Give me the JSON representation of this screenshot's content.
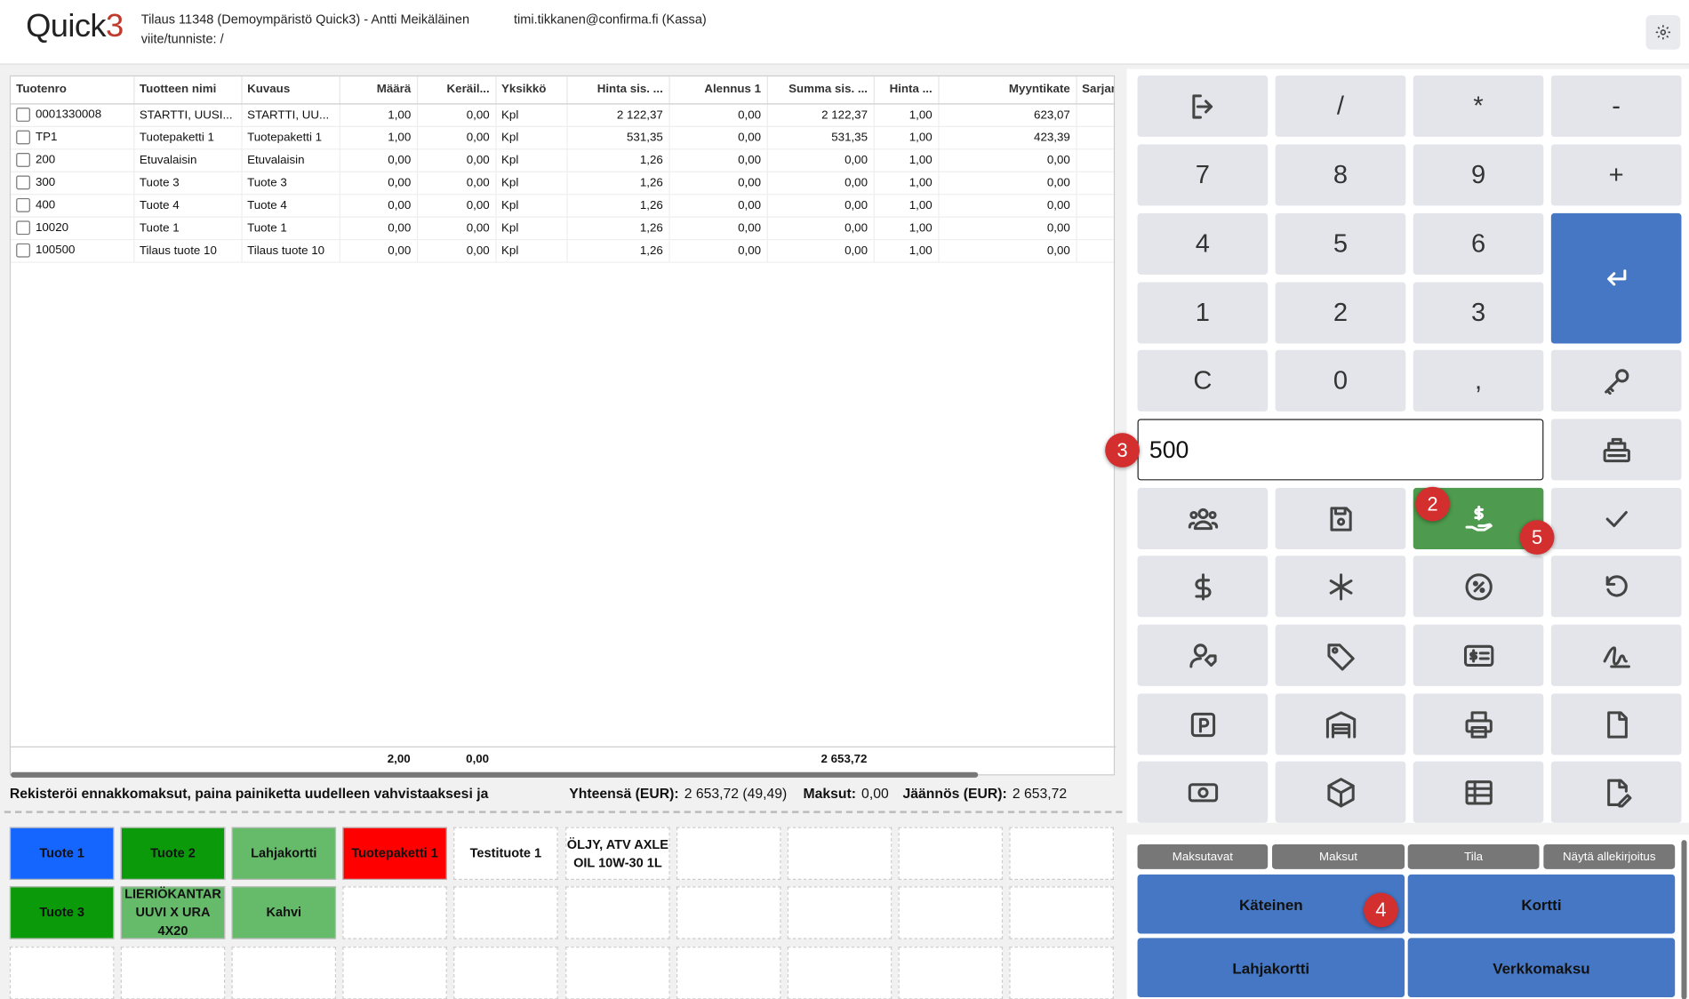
{
  "header": {
    "logo_text": "Quick",
    "logo_num": "3",
    "order_line": "Tilaus 11348 (Demoympäristö Quick3) - Antti Meikäläinen",
    "ref_line": "viite/tunniste: /",
    "user": "timi.tikkanen@confirma.fi (Kassa)"
  },
  "table": {
    "columns": [
      "Tuotenro",
      "Tuotteen nimi",
      "Kuvaus",
      "Määrä",
      "Keräil...",
      "Yksikkö",
      "Hinta sis. ...",
      "Alennus 1",
      "Summa sis. ...",
      "Hinta ...",
      "Myyntikate",
      "Sarjan"
    ],
    "rows": [
      [
        "0001330008",
        "STARTTI, UUSI...",
        "STARTTI, UU...",
        "1,00",
        "0,00",
        "Kpl",
        "2 122,37",
        "0,00",
        "2 122,37",
        "1,00",
        "623,07",
        ""
      ],
      [
        "TP1",
        "Tuotepaketti 1",
        "Tuotepaketti 1",
        "1,00",
        "0,00",
        "Kpl",
        "531,35",
        "0,00",
        "531,35",
        "1,00",
        "423,39",
        ""
      ],
      [
        "200",
        "Etuvalaisin",
        "Etuvalaisin",
        "0,00",
        "0,00",
        "Kpl",
        "1,26",
        "0,00",
        "0,00",
        "1,00",
        "0,00",
        ""
      ],
      [
        "300",
        "Tuote 3",
        "Tuote 3",
        "0,00",
        "0,00",
        "Kpl",
        "1,26",
        "0,00",
        "0,00",
        "1,00",
        "0,00",
        ""
      ],
      [
        "400",
        "Tuote 4",
        "Tuote 4",
        "0,00",
        "0,00",
        "Kpl",
        "1,26",
        "0,00",
        "0,00",
        "1,00",
        "0,00",
        ""
      ],
      [
        "10020",
        "Tuote 1",
        "Tuote 1",
        "0,00",
        "0,00",
        "Kpl",
        "1,26",
        "0,00",
        "0,00",
        "1,00",
        "0,00",
        ""
      ],
      [
        "100500",
        "Tilaus tuote 10",
        "Tilaus tuote 10",
        "0,00",
        "0,00",
        "Kpl",
        "1,26",
        "0,00",
        "0,00",
        "1,00",
        "0,00",
        ""
      ]
    ],
    "totals": {
      "maara": "2,00",
      "kerail": "0,00",
      "summa": "2 653,72"
    }
  },
  "status": {
    "message": "Rekisteröi ennakkomaksut, paina painiketta uudelleen vahvistaaksesi ja",
    "total_label": "Yhteensä (EUR):",
    "total_value": "2 653,72 (49,49)",
    "paid_label": "Maksut:",
    "paid_value": "0,00",
    "rest_label": "Jäännös (EUR):",
    "rest_value": "2 653,72"
  },
  "quick_buttons": [
    {
      "label": "Tuote 1",
      "color": "#1565ff"
    },
    {
      "label": "Tuote 2",
      "color": "#0a9a0a"
    },
    {
      "label": "Lahjakortti",
      "color": "#66bb6a"
    },
    {
      "label": "Tuotepaketti 1",
      "color": "#ff0000"
    },
    {
      "label": "Testituote 1",
      "color": "#ffffff"
    },
    {
      "label": "ÖLJY, ATV AXLE OIL 10W-30 1L",
      "color": "#ffffff"
    },
    {
      "label": "",
      "color": "#ffffff"
    },
    {
      "label": "",
      "color": "#ffffff"
    },
    {
      "label": "",
      "color": "#ffffff"
    },
    {
      "label": "",
      "color": "#ffffff"
    },
    {
      "label": "Tuote 3",
      "color": "#0a9a0a"
    },
    {
      "label": "LIERIÖKANTAR UUVI X URA 4X20",
      "color": "#66bb6a"
    },
    {
      "label": "Kahvi",
      "color": "#66bb6a"
    },
    {
      "label": "",
      "color": "#ffffff"
    },
    {
      "label": "",
      "color": "#ffffff"
    },
    {
      "label": "",
      "color": "#ffffff"
    },
    {
      "label": "",
      "color": "#ffffff"
    },
    {
      "label": "",
      "color": "#ffffff"
    },
    {
      "label": "",
      "color": "#ffffff"
    },
    {
      "label": "",
      "color": "#ffffff"
    },
    {
      "label": "",
      "color": "#ffffff"
    },
    {
      "label": "",
      "color": "#ffffff"
    },
    {
      "label": "",
      "color": "#ffffff"
    },
    {
      "label": "",
      "color": "#ffffff"
    },
    {
      "label": "",
      "color": "#ffffff"
    },
    {
      "label": "",
      "color": "#ffffff"
    },
    {
      "label": "",
      "color": "#ffffff"
    },
    {
      "label": "",
      "color": "#ffffff"
    },
    {
      "label": "",
      "color": "#ffffff"
    },
    {
      "label": "",
      "color": "#ffffff"
    }
  ],
  "keypad": {
    "slash": "/",
    "star": "*",
    "minus": "-",
    "k7": "7",
    "k8": "8",
    "k9": "9",
    "plus": "+",
    "k4": "4",
    "k5": "5",
    "k6": "6",
    "k1": "1",
    "k2": "2",
    "k3": "3",
    "clear": "C",
    "k0": "0",
    "comma": ","
  },
  "amount_input": {
    "value": "500"
  },
  "badges": [
    "2",
    "3",
    "4",
    "5"
  ],
  "payment": {
    "tabs": [
      "Maksutavat",
      "Maksut",
      "Tila",
      "Näytä allekirjoitus"
    ],
    "methods": [
      "Käteinen",
      "Kortti",
      "Lahjakortti",
      "Verkkomaksu"
    ]
  },
  "colors": {
    "accent_blue": "#4577c4",
    "pay_green": "#4e9a4e",
    "badge_red": "#d32f2f"
  }
}
